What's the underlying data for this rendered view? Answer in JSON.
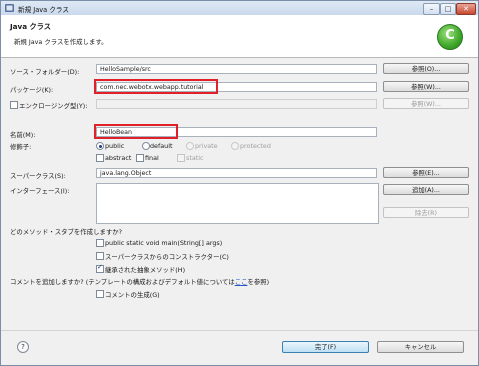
{
  "window": {
    "title": "新規 Java クラス",
    "buttons": {
      "minimize": "–",
      "maximize": "□",
      "close": "✕"
    }
  },
  "header": {
    "title": "Java クラス",
    "description": "新規 Java クラスを作成します。",
    "icon": "new-class-wizard-icon",
    "icon_letter": "C"
  },
  "form": {
    "source_folder": {
      "label": "ソース・フォルダー(D):",
      "value": "HelloSample/src",
      "button": "参照(O)..."
    },
    "package": {
      "label": "パッケージ(K):",
      "value": "com.nec.webotx.webapp.tutorial",
      "button": "参照(W)..."
    },
    "enclosing": {
      "label": "エンクロージング型(Y):",
      "value": "",
      "button": "参照(W)..."
    },
    "name": {
      "label": "名前(M):",
      "value": "HelloBean"
    },
    "modifiers": {
      "label": "修飾子:",
      "access": [
        "public",
        "default",
        "private",
        "protected"
      ],
      "selected": "public",
      "abstract": "abstract",
      "final": "final",
      "static": "static"
    },
    "superclass": {
      "label": "スーパークラス(S):",
      "value": "java.lang.Object",
      "button": "参照(E)..."
    },
    "interfaces": {
      "label": "インターフェース(I):",
      "add_button": "追加(A)...",
      "remove_button": "除去(R)"
    }
  },
  "stubs": {
    "question": "どのメソッド・スタブを作成しますか?",
    "options": [
      {
        "label": "public static void main(String[] args)",
        "checked": false
      },
      {
        "label": "スーパークラスからのコンストラクター(C)",
        "checked": false
      },
      {
        "label": "継承された抽象メソッド(H)",
        "checked": true
      }
    ]
  },
  "comments": {
    "question_before": "コメントを追加しますか? (テンプレートの構成およびデフォルト値については",
    "link": "ここ",
    "question_after": "を参照)",
    "generate": {
      "label": "コメントの生成(G)",
      "checked": false
    }
  },
  "footer": {
    "help_icon": "help-icon",
    "finish": "完了(F)",
    "cancel": "キャンセル"
  },
  "colors": {
    "highlight": "#e0202a",
    "accent": "#2a55c7",
    "titlebar": "#c9d9ec"
  }
}
